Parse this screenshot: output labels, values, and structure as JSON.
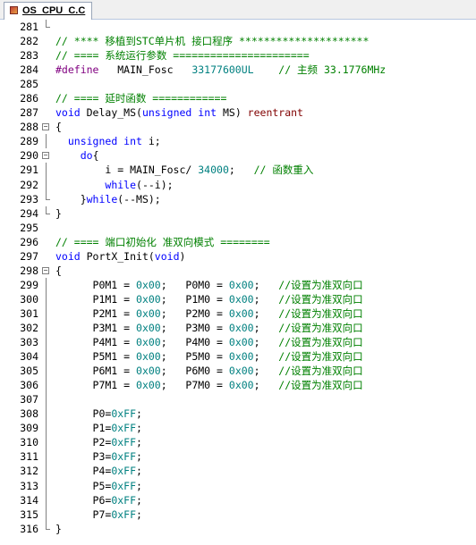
{
  "tab": {
    "title": "OS_CPU_C.C"
  },
  "lines": [
    {
      "n": "281",
      "fold": "end",
      "segs": []
    },
    {
      "n": "282",
      "fold": "",
      "segs": [
        {
          "t": "cm",
          "v": "// **** 移植到STC单片机 接口程序 *********************"
        }
      ]
    },
    {
      "n": "283",
      "fold": "",
      "segs": [
        {
          "t": "cm",
          "v": "// ==== 系统运行参数 ======================"
        }
      ]
    },
    {
      "n": "284",
      "fold": "",
      "segs": [
        {
          "t": "pp",
          "v": "#define"
        },
        {
          "t": "pl",
          "v": "   MAIN_Fosc   "
        },
        {
          "t": "num",
          "v": "33177600UL"
        },
        {
          "t": "pl",
          "v": "    "
        },
        {
          "t": "cm",
          "v": "// 主频 33.1776MHz"
        }
      ]
    },
    {
      "n": "285",
      "fold": "",
      "segs": []
    },
    {
      "n": "286",
      "fold": "",
      "segs": [
        {
          "t": "cm",
          "v": "// ==== 延时函数 ============"
        }
      ]
    },
    {
      "n": "287",
      "fold": "",
      "segs": [
        {
          "t": "kw",
          "v": "void"
        },
        {
          "t": "pl",
          "v": " Delay_MS("
        },
        {
          "t": "kw",
          "v": "unsigned int"
        },
        {
          "t": "pl",
          "v": " MS) "
        },
        {
          "t": "rsv",
          "v": "reentrant"
        }
      ]
    },
    {
      "n": "288",
      "fold": "open",
      "segs": [
        {
          "t": "pl",
          "v": "{"
        }
      ]
    },
    {
      "n": "289",
      "fold": "line",
      "segs": [
        {
          "t": "pl",
          "v": "  "
        },
        {
          "t": "kw",
          "v": "unsigned int"
        },
        {
          "t": "pl",
          "v": " i;"
        }
      ]
    },
    {
      "n": "290",
      "fold": "open",
      "segs": [
        {
          "t": "pl",
          "v": "    "
        },
        {
          "t": "kw",
          "v": "do"
        },
        {
          "t": "pl",
          "v": "{"
        }
      ]
    },
    {
      "n": "291",
      "fold": "line",
      "segs": [
        {
          "t": "pl",
          "v": "        i = MAIN_Fosc/ "
        },
        {
          "t": "num",
          "v": "34000"
        },
        {
          "t": "pl",
          "v": ";   "
        },
        {
          "t": "cm",
          "v": "// 函数重入"
        }
      ]
    },
    {
      "n": "292",
      "fold": "line",
      "segs": [
        {
          "t": "pl",
          "v": "        "
        },
        {
          "t": "kw",
          "v": "while"
        },
        {
          "t": "pl",
          "v": "(--i);"
        }
      ]
    },
    {
      "n": "293",
      "fold": "end",
      "segs": [
        {
          "t": "pl",
          "v": "    }"
        },
        {
          "t": "kw",
          "v": "while"
        },
        {
          "t": "pl",
          "v": "(--MS);"
        }
      ]
    },
    {
      "n": "294",
      "fold": "end",
      "segs": [
        {
          "t": "pl",
          "v": "}"
        }
      ]
    },
    {
      "n": "295",
      "fold": "",
      "segs": []
    },
    {
      "n": "296",
      "fold": "",
      "segs": [
        {
          "t": "cm",
          "v": "// ==== 端口初始化 准双向模式 ========"
        }
      ]
    },
    {
      "n": "297",
      "fold": "",
      "segs": [
        {
          "t": "kw",
          "v": "void"
        },
        {
          "t": "pl",
          "v": " PortX_Init("
        },
        {
          "t": "kw",
          "v": "void"
        },
        {
          "t": "pl",
          "v": ")"
        }
      ]
    },
    {
      "n": "298",
      "fold": "open",
      "segs": [
        {
          "t": "pl",
          "v": "{"
        }
      ]
    },
    {
      "n": "299",
      "fold": "line",
      "segs": [
        {
          "t": "pl",
          "v": "      P0M1 = "
        },
        {
          "t": "num",
          "v": "0x00"
        },
        {
          "t": "pl",
          "v": ";   P0M0 = "
        },
        {
          "t": "num",
          "v": "0x00"
        },
        {
          "t": "pl",
          "v": ";   "
        },
        {
          "t": "cm",
          "v": "//设置为准双向口"
        }
      ]
    },
    {
      "n": "300",
      "fold": "line",
      "segs": [
        {
          "t": "pl",
          "v": "      P1M1 = "
        },
        {
          "t": "num",
          "v": "0x00"
        },
        {
          "t": "pl",
          "v": ";   P1M0 = "
        },
        {
          "t": "num",
          "v": "0x00"
        },
        {
          "t": "pl",
          "v": ";   "
        },
        {
          "t": "cm",
          "v": "//设置为准双向口"
        }
      ]
    },
    {
      "n": "301",
      "fold": "line",
      "segs": [
        {
          "t": "pl",
          "v": "      P2M1 = "
        },
        {
          "t": "num",
          "v": "0x00"
        },
        {
          "t": "pl",
          "v": ";   P2M0 = "
        },
        {
          "t": "num",
          "v": "0x00"
        },
        {
          "t": "pl",
          "v": ";   "
        },
        {
          "t": "cm",
          "v": "//设置为准双向口"
        }
      ]
    },
    {
      "n": "302",
      "fold": "line",
      "segs": [
        {
          "t": "pl",
          "v": "      P3M1 = "
        },
        {
          "t": "num",
          "v": "0x00"
        },
        {
          "t": "pl",
          "v": ";   P3M0 = "
        },
        {
          "t": "num",
          "v": "0x00"
        },
        {
          "t": "pl",
          "v": ";   "
        },
        {
          "t": "cm",
          "v": "//设置为准双向口"
        }
      ]
    },
    {
      "n": "303",
      "fold": "line",
      "segs": [
        {
          "t": "pl",
          "v": "      P4M1 = "
        },
        {
          "t": "num",
          "v": "0x00"
        },
        {
          "t": "pl",
          "v": ";   P4M0 = "
        },
        {
          "t": "num",
          "v": "0x00"
        },
        {
          "t": "pl",
          "v": ";   "
        },
        {
          "t": "cm",
          "v": "//设置为准双向口"
        }
      ]
    },
    {
      "n": "304",
      "fold": "line",
      "segs": [
        {
          "t": "pl",
          "v": "      P5M1 = "
        },
        {
          "t": "num",
          "v": "0x00"
        },
        {
          "t": "pl",
          "v": ";   P5M0 = "
        },
        {
          "t": "num",
          "v": "0x00"
        },
        {
          "t": "pl",
          "v": ";   "
        },
        {
          "t": "cm",
          "v": "//设置为准双向口"
        }
      ]
    },
    {
      "n": "305",
      "fold": "line",
      "segs": [
        {
          "t": "pl",
          "v": "      P6M1 = "
        },
        {
          "t": "num",
          "v": "0x00"
        },
        {
          "t": "pl",
          "v": ";   P6M0 = "
        },
        {
          "t": "num",
          "v": "0x00"
        },
        {
          "t": "pl",
          "v": ";   "
        },
        {
          "t": "cm",
          "v": "//设置为准双向口"
        }
      ]
    },
    {
      "n": "306",
      "fold": "line",
      "segs": [
        {
          "t": "pl",
          "v": "      P7M1 = "
        },
        {
          "t": "num",
          "v": "0x00"
        },
        {
          "t": "pl",
          "v": ";   P7M0 = "
        },
        {
          "t": "num",
          "v": "0x00"
        },
        {
          "t": "pl",
          "v": ";   "
        },
        {
          "t": "cm",
          "v": "//设置为准双向口"
        }
      ]
    },
    {
      "n": "307",
      "fold": "line",
      "segs": []
    },
    {
      "n": "308",
      "fold": "line",
      "segs": [
        {
          "t": "pl",
          "v": "      P0="
        },
        {
          "t": "num",
          "v": "0xFF"
        },
        {
          "t": "pl",
          "v": ";"
        }
      ]
    },
    {
      "n": "309",
      "fold": "line",
      "segs": [
        {
          "t": "pl",
          "v": "      P1="
        },
        {
          "t": "num",
          "v": "0xFF"
        },
        {
          "t": "pl",
          "v": ";"
        }
      ]
    },
    {
      "n": "310",
      "fold": "line",
      "segs": [
        {
          "t": "pl",
          "v": "      P2="
        },
        {
          "t": "num",
          "v": "0xFF"
        },
        {
          "t": "pl",
          "v": ";"
        }
      ]
    },
    {
      "n": "311",
      "fold": "line",
      "segs": [
        {
          "t": "pl",
          "v": "      P3="
        },
        {
          "t": "num",
          "v": "0xFF"
        },
        {
          "t": "pl",
          "v": ";"
        }
      ]
    },
    {
      "n": "312",
      "fold": "line",
      "segs": [
        {
          "t": "pl",
          "v": "      P4="
        },
        {
          "t": "num",
          "v": "0xFF"
        },
        {
          "t": "pl",
          "v": ";"
        }
      ]
    },
    {
      "n": "313",
      "fold": "line",
      "segs": [
        {
          "t": "pl",
          "v": "      P5="
        },
        {
          "t": "num",
          "v": "0xFF"
        },
        {
          "t": "pl",
          "v": ";"
        }
      ]
    },
    {
      "n": "314",
      "fold": "line",
      "segs": [
        {
          "t": "pl",
          "v": "      P6="
        },
        {
          "t": "num",
          "v": "0xFF"
        },
        {
          "t": "pl",
          "v": ";"
        }
      ]
    },
    {
      "n": "315",
      "fold": "line",
      "segs": [
        {
          "t": "pl",
          "v": "      P7="
        },
        {
          "t": "num",
          "v": "0xFF"
        },
        {
          "t": "pl",
          "v": ";"
        }
      ]
    },
    {
      "n": "316",
      "fold": "end",
      "segs": [
        {
          "t": "pl",
          "v": "}"
        }
      ]
    }
  ]
}
